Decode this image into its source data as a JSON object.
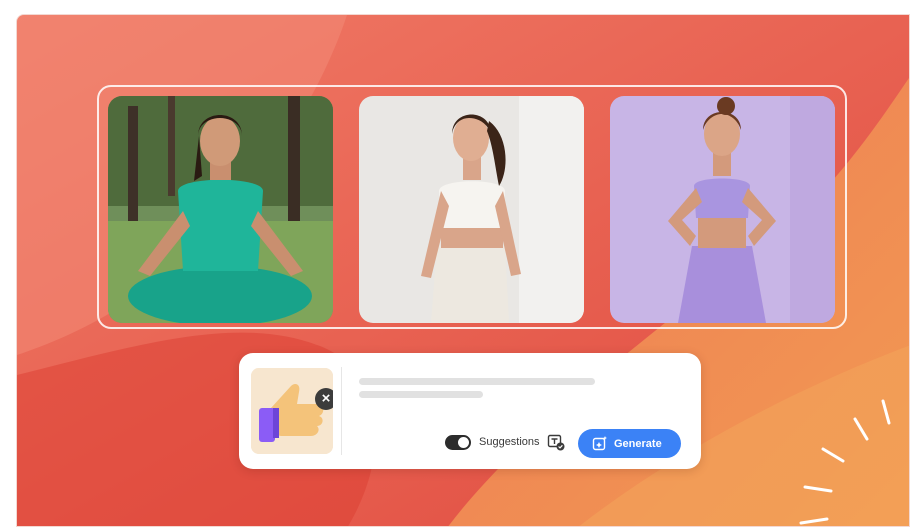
{
  "colors": {
    "background_red": "#e8584a",
    "background_orange": "#ef8a50",
    "accent_blue": "#3b82f6"
  },
  "gallery": {
    "images": [
      {
        "name": "woman-meditating-green-outfit"
      },
      {
        "name": "woman-white-sports-outfit"
      },
      {
        "name": "woman-lavender-sports-outfit"
      }
    ]
  },
  "prompt_panel": {
    "reference_image": "thumbs-up-hand-icon",
    "remove_icon": "close-icon",
    "suggestions_label": "Suggestions",
    "suggestions_enabled": true,
    "generate_label": "Generate"
  }
}
